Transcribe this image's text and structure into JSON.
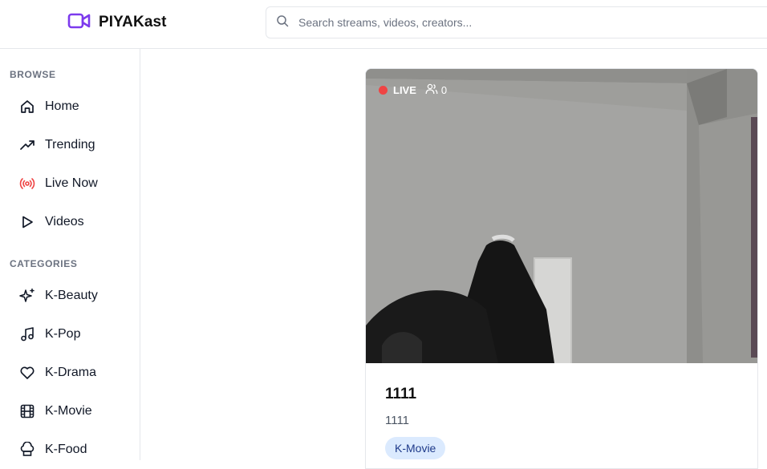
{
  "app": {
    "name": "PIYAKast",
    "brand_color": "#7c3aed"
  },
  "search": {
    "placeholder": "Search streams, videos, creators..."
  },
  "sidebar": {
    "browse_title": "BROWSE",
    "browse": [
      {
        "label": "Home",
        "icon": "home-icon"
      },
      {
        "label": "Trending",
        "icon": "trending-icon"
      },
      {
        "label": "Live Now",
        "icon": "broadcast-icon",
        "color": "#ef4444"
      },
      {
        "label": "Videos",
        "icon": "play-icon"
      }
    ],
    "categories_title": "CATEGORIES",
    "categories": [
      {
        "label": "K-Beauty",
        "icon": "sparkles-icon"
      },
      {
        "label": "K-Pop",
        "icon": "music-icon"
      },
      {
        "label": "K-Drama",
        "icon": "heart-icon"
      },
      {
        "label": "K-Movie",
        "icon": "film-icon"
      },
      {
        "label": "K-Food",
        "icon": "chef-hat-icon"
      }
    ]
  },
  "stream": {
    "live_label": "LIVE",
    "viewer_count": "0",
    "title": "1111",
    "description": "1111",
    "category_tag": "K-Movie"
  }
}
